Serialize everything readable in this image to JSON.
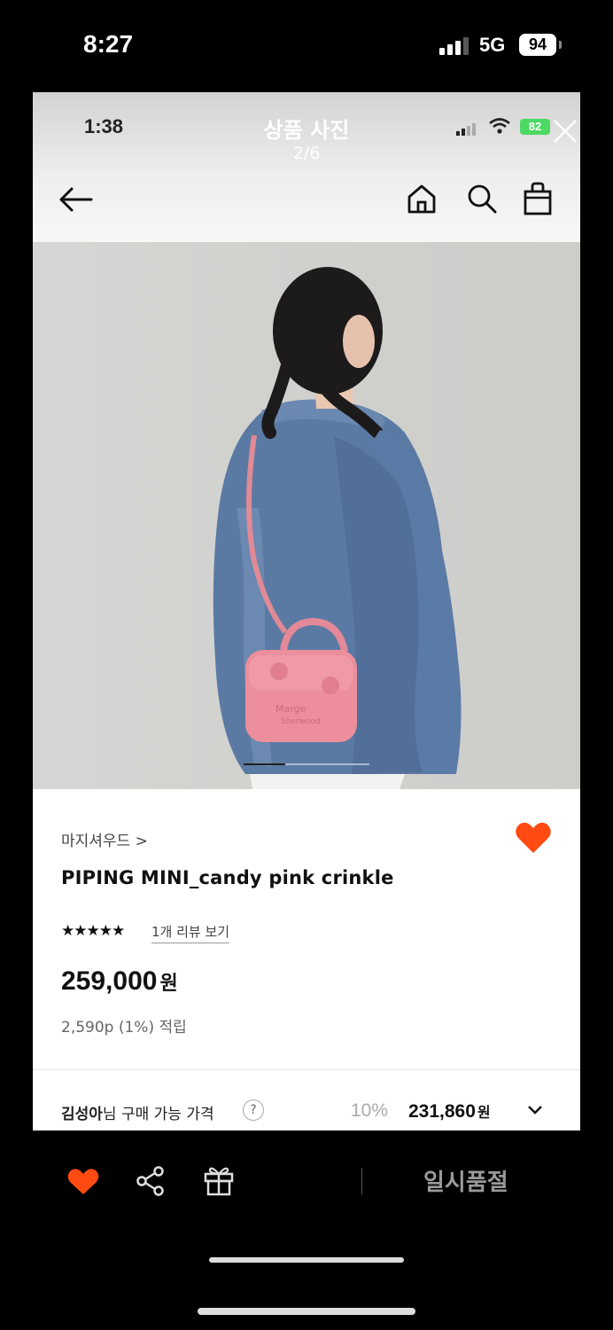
{
  "status_bar": {
    "time": "8:27",
    "network": "5G",
    "battery": "94"
  },
  "embedded_status": {
    "time": "1:38",
    "battery": "82"
  },
  "gallery": {
    "title": "상품 사진",
    "counter": "2/6",
    "progress": 0.333
  },
  "header": {
    "back_icon": "arrow-left-icon",
    "home_icon": "home-icon",
    "search_icon": "search-icon",
    "bag_icon": "shopping-bag-icon"
  },
  "product": {
    "image_desc_icon": "product-photo",
    "brand": "마지셔우드 >",
    "name": "PIPING MINI_candy pink crinkle",
    "stars": "★★★★★",
    "rating": 5,
    "review_link": "1개 리뷰 보기",
    "price": "259,000",
    "price_unit": "원",
    "points": "2,590p (1%) 적립",
    "wish_color": "#ff4a12"
  },
  "member_price": {
    "name": "김성아",
    "label": "님 구매 가능 가격",
    "help": "?",
    "discount_rate": "10%",
    "price": "231,860",
    "unit": "원"
  },
  "bottom_bar": {
    "wish_color": "#ff4a12",
    "soldout_label": "일시품절"
  }
}
